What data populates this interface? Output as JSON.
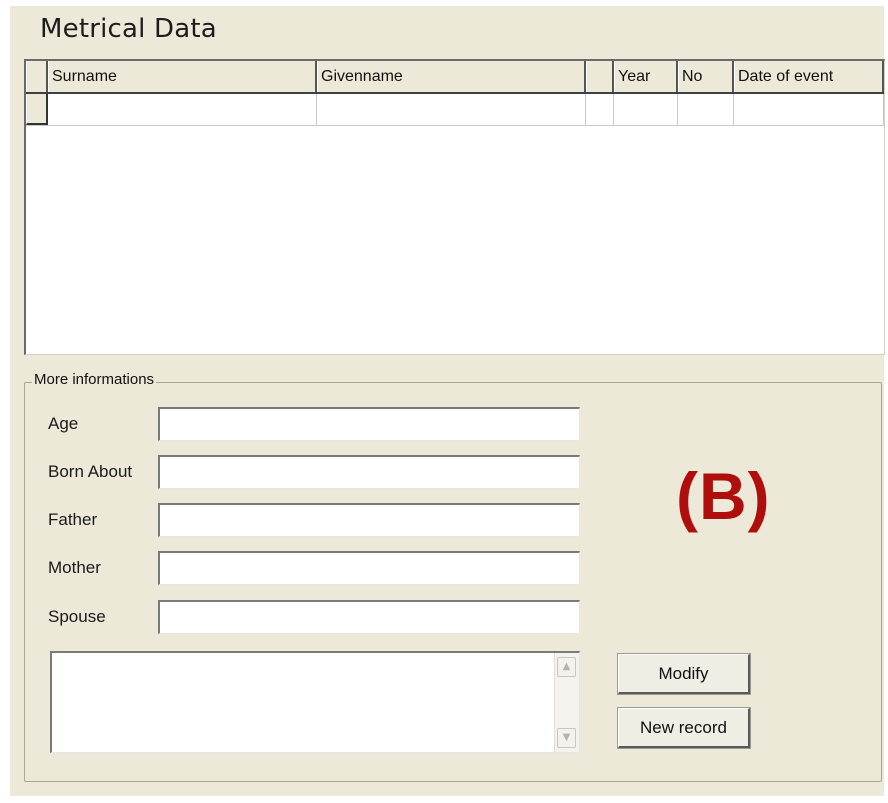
{
  "title": "Metrical Data",
  "grid": {
    "columns": [
      "",
      "Surname",
      "Givenname",
      "",
      "Year",
      "No",
      "Date of event"
    ],
    "rows": [
      [
        "",
        "",
        "",
        "",
        "",
        "",
        ""
      ]
    ]
  },
  "more_info": {
    "legend": "More informations",
    "fields": [
      {
        "label": "Age",
        "value": ""
      },
      {
        "label": "Born About",
        "value": ""
      },
      {
        "label": "Father",
        "value": ""
      },
      {
        "label": "Mother",
        "value": ""
      },
      {
        "label": "Spouse",
        "value": ""
      }
    ],
    "notes_value": ""
  },
  "buttons": {
    "modify": "Modify",
    "new_record": "New record"
  },
  "annotation": {
    "text": "(B)",
    "color": "#b00d0d"
  },
  "icons": {
    "scroll_up": "chevron-up-icon",
    "scroll_down": "chevron-down-icon"
  }
}
